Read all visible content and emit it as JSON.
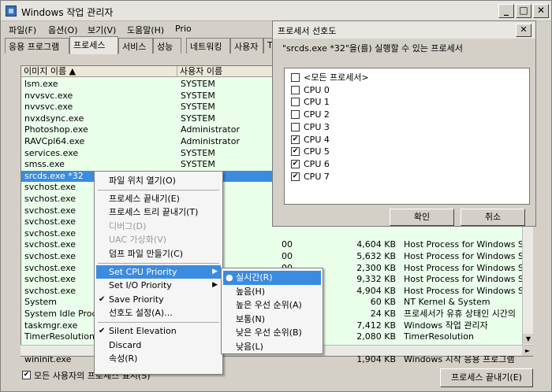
{
  "window": {
    "title": "Windows 작업 관리자"
  },
  "menu": [
    "파일(F)",
    "옵션(O)",
    "보기(V)",
    "도움말(H)",
    "Prio"
  ],
  "tabs": [
    "응용 프로그램",
    "프로세스",
    "서비스",
    "성능",
    "네트워킹",
    "사용자",
    "TC"
  ],
  "columns": {
    "image": "이미지 이름",
    "user": "사용자 이름"
  },
  "rows": [
    {
      "name": "lsm.exe",
      "user": "SYSTEM"
    },
    {
      "name": "nvvsvc.exe",
      "user": "SYSTEM"
    },
    {
      "name": "nvvsvc.exe",
      "user": "SYSTEM"
    },
    {
      "name": "nvxdsync.exe",
      "user": "SYSTEM"
    },
    {
      "name": "Photoshop.exe",
      "user": "Administrator"
    },
    {
      "name": "RAVCpl64.exe",
      "user": "Administrator"
    },
    {
      "name": "services.exe",
      "user": "SYSTEM"
    },
    {
      "name": "smss.exe",
      "user": "SYSTEM"
    },
    {
      "name": "srcds.exe *32",
      "user": "ator"
    },
    {
      "name": "svchost.exe",
      "user": ""
    },
    {
      "name": "svchost.exe",
      "user": "RVICE"
    },
    {
      "name": "svchost.exe",
      "user": ""
    },
    {
      "name": "svchost.exe",
      "user": "RVICE"
    },
    {
      "name": "svchost.exe",
      "user": ""
    },
    {
      "name": "svchost.exe",
      "user": ". SERVICE",
      "cpu": "00",
      "mem": "4,604 KB",
      "desc": "Host Process for Windows Se"
    },
    {
      "name": "svchost.exe",
      "user": ". SERVICE",
      "cpu": "00",
      "mem": "5,632 KB",
      "desc": "Host Process for Windows Se"
    },
    {
      "name": "svchost.exe",
      "user": "",
      "cpu": "00",
      "mem": "2,300 KB",
      "desc": "Host Process for Windows Se"
    },
    {
      "name": "svchost.exe",
      "user": "SERVICE",
      "cpu": "00",
      "mem": "9,332 KB",
      "desc": "Host Process for Windows Se"
    },
    {
      "name": "svchost.exe",
      "user": "",
      "cpu": "00",
      "mem": "4,904 KB",
      "desc": "Host Process for Windows Se"
    },
    {
      "name": "System",
      "user": "",
      "cpu": "",
      "mem": "60 KB",
      "desc": "NT Kernel & System"
    },
    {
      "name": "System Idle Proc",
      "user": "",
      "cpu": "",
      "mem": "24 KB",
      "desc": "프로세서가 유휴 상태인 시간의"
    },
    {
      "name": "taskmgr.exe",
      "user": "",
      "cpu": "",
      "mem": "7,412 KB",
      "desc": "Windows 작업 관리자"
    },
    {
      "name": "TimerResolution",
      "user": "",
      "cpu": "",
      "mem": "2,080 KB",
      "desc": "TimerResolution"
    },
    {
      "name": "WebShare.exe *3",
      "user": "",
      "cpu": "",
      "mem": "4,216 KB",
      "desc": "Berryz WebShare"
    },
    {
      "name": "wininit.exe",
      "user": "",
      "cpu": "",
      "mem": "1,904 KB",
      "desc": "Windows 시작 응용 프로그램"
    }
  ],
  "footer": {
    "show_all": "모든 사용자의 프로세스 표시(S)",
    "end_process": "프로세스 끝내기(E)"
  },
  "dialog": {
    "title": "프로세서 선호도",
    "message": "\"srcds.exe *32\"을(를) 실행할 수 있는 프로세서",
    "items": [
      {
        "label": "<모든 프로세서>",
        "checked": false
      },
      {
        "label": "CPU 0",
        "checked": false
      },
      {
        "label": "CPU 1",
        "checked": false
      },
      {
        "label": "CPU 2",
        "checked": false
      },
      {
        "label": "CPU 3",
        "checked": false
      },
      {
        "label": "CPU 4",
        "checked": true
      },
      {
        "label": "CPU 5",
        "checked": true
      },
      {
        "label": "CPU 6",
        "checked": true
      },
      {
        "label": "CPU 7",
        "checked": true
      }
    ],
    "ok": "확인",
    "cancel": "취소"
  },
  "context_menu": {
    "items": [
      {
        "label": "파일 위치 열기(O)"
      },
      {
        "sep": true
      },
      {
        "label": "프로세스 끝내기(E)"
      },
      {
        "label": "프로세스 트리 끝내기(T)"
      },
      {
        "label": "디버그(D)",
        "disabled": true
      },
      {
        "label": "UAC 가상화(V)",
        "disabled": true
      },
      {
        "label": "덤프 파일 만들기(C)"
      },
      {
        "sep": true
      },
      {
        "label": "Set CPU Priority",
        "submenu": true,
        "highlight": true
      },
      {
        "label": "Set I/O Priority",
        "submenu": true
      },
      {
        "label": "Save Priority",
        "check": true
      },
      {
        "label": "선호도 설정(A)..."
      },
      {
        "sep": true
      },
      {
        "label": "Silent Elevation",
        "check": true
      },
      {
        "label": "Discard"
      },
      {
        "label": "속성(R)"
      }
    ]
  },
  "priority_menu": {
    "items": [
      {
        "label": "실시간(R)",
        "selected": true
      },
      {
        "label": "높음(H)"
      },
      {
        "label": "높은 우선 순위(A)"
      },
      {
        "label": "보통(N)"
      },
      {
        "label": "낮은 우선 순위(B)"
      },
      {
        "label": "낮음(L)"
      }
    ]
  },
  "colors": {
    "selection": "#3b8be0",
    "list_bg": "#eaffea"
  }
}
